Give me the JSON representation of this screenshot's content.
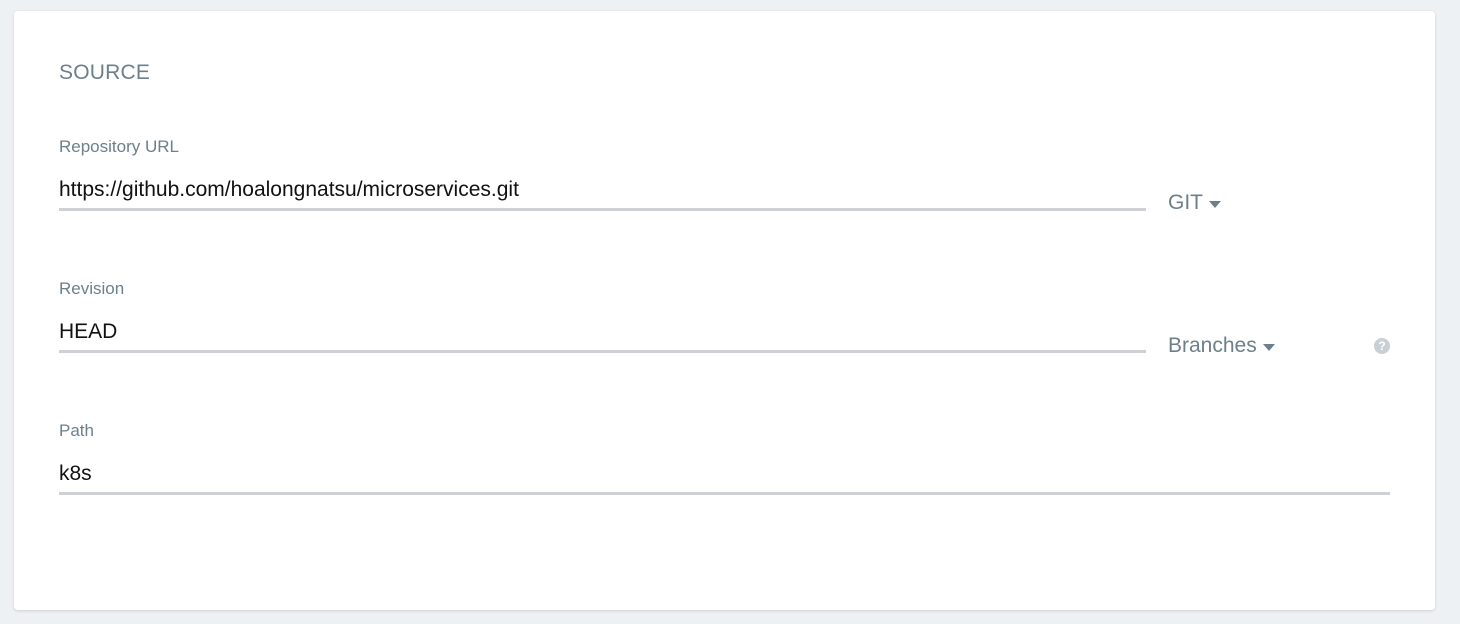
{
  "section": {
    "title": "SOURCE"
  },
  "fields": {
    "repository_url": {
      "label": "Repository URL",
      "value": "https://github.com/hoalongnatsu/microservices.git",
      "type_dropdown": "GIT"
    },
    "revision": {
      "label": "Revision",
      "value": "HEAD",
      "ref_dropdown": "Branches",
      "help_icon": "?"
    },
    "path": {
      "label": "Path",
      "value": "k8s"
    }
  },
  "icons": {
    "help": "question-circle-icon",
    "caret": "caret-down-icon"
  },
  "colors": {
    "label": "#6d7f8b",
    "input_underline": "#cdd1d5",
    "help_icon": "#c8d0d6",
    "background": "#eef1f4"
  }
}
